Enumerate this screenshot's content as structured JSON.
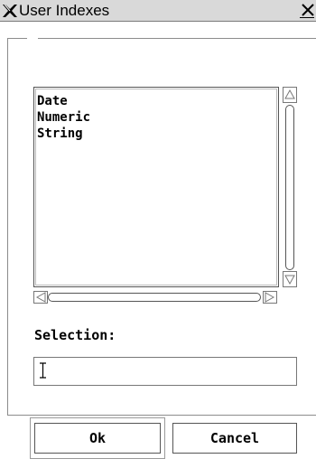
{
  "window": {
    "title": "User Indexes",
    "logo": "X-logo-icon",
    "close_icon": "close-icon"
  },
  "list": {
    "items": [
      "Date",
      "Numeric",
      "String"
    ]
  },
  "selection": {
    "label": "Selection:",
    "value": ""
  },
  "buttons": {
    "ok_label": "Ok",
    "cancel_label": "Cancel"
  }
}
